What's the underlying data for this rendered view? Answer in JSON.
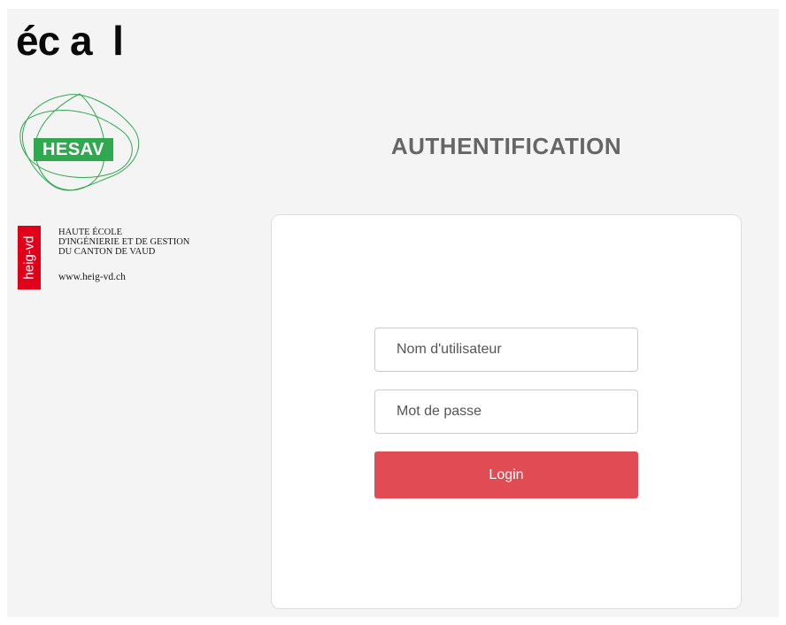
{
  "logos": {
    "ecal": "éc a  l",
    "hesav": "HESAV",
    "heig": {
      "badge": "heig-vd",
      "line1": "HAUTE ÉCOLE",
      "line2": "D'INGÉNIERIE ET DE GESTION",
      "line3": "DU CANTON DE VAUD",
      "url": "www.heig-vd.ch"
    }
  },
  "auth": {
    "title": "AUTHENTIFICATION",
    "username_placeholder": "Nom d'utilisateur",
    "password_placeholder": "Mot de passe",
    "login_label": "Login"
  },
  "colors": {
    "page_background": "#f4f4f4",
    "title": "#666666",
    "login_button": "#e04b54",
    "hesav_green": "#2fa84f",
    "heig_red": "#e1001a"
  }
}
